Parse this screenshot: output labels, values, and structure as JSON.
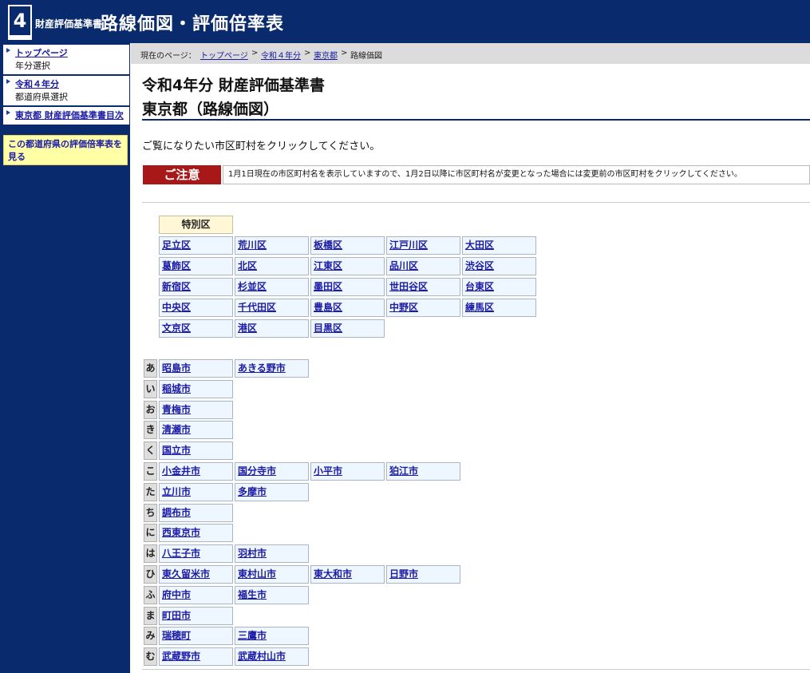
{
  "header": {
    "logo_number": "4",
    "subtitle": "財産評価基準書",
    "title": "路線価図・評価倍率表"
  },
  "sidebar": {
    "items": [
      {
        "link": "トップページ",
        "sub": "年分選択"
      },
      {
        "link": "令和４年分",
        "sub": "都道府県選択"
      },
      {
        "link": "東京都  財産評価基準書目次",
        "sub": ""
      }
    ],
    "notice": "この都道府県の評価倍率表を見る"
  },
  "breadcrumb": {
    "label": "現在のページ：",
    "items": [
      "トップページ",
      "令和４年分",
      "東京都",
      "路線価図"
    ],
    "sep": ">"
  },
  "main": {
    "title_line1": "令和4年分 財産評価基準書",
    "title_line2": "東京都（路線価図）",
    "instruction": "ご覧になりたい市区町村をクリックしてください。",
    "notice_label": "ご注意",
    "notice_text": "1月1日現在の市区町村名を表示していますので、1月2日以降に市区町村名が変更となった場合には変更前の市区町村をクリックしてください。"
  },
  "wards": {
    "header": "特別区",
    "rows": [
      [
        "足立区",
        "荒川区",
        "板橋区",
        "江戸川区",
        "大田区"
      ],
      [
        "葛飾区",
        "北区",
        "江東区",
        "品川区",
        "渋谷区"
      ],
      [
        "新宿区",
        "杉並区",
        "墨田区",
        "世田谷区",
        "台東区"
      ],
      [
        "中央区",
        "千代田区",
        "豊島区",
        "中野区",
        "練馬区"
      ],
      [
        "文京区",
        "港区",
        "目黒区"
      ]
    ]
  },
  "cities": [
    {
      "kana": "あ",
      "items": [
        "昭島市",
        "あきる野市"
      ]
    },
    {
      "kana": "い",
      "items": [
        "稲城市"
      ]
    },
    {
      "kana": "お",
      "items": [
        "青梅市"
      ]
    },
    {
      "kana": "き",
      "items": [
        "清瀬市"
      ]
    },
    {
      "kana": "く",
      "items": [
        "国立市"
      ]
    },
    {
      "kana": "こ",
      "items": [
        "小金井市",
        "国分寺市",
        "小平市",
        "狛江市"
      ]
    },
    {
      "kana": "た",
      "items": [
        "立川市",
        "多摩市"
      ]
    },
    {
      "kana": "ち",
      "items": [
        "調布市"
      ]
    },
    {
      "kana": "に",
      "items": [
        "西東京市"
      ]
    },
    {
      "kana": "は",
      "items": [
        "八王子市",
        "羽村市"
      ]
    },
    {
      "kana": "ひ",
      "items": [
        "東久留米市",
        "東村山市",
        "東大和市",
        "日野市"
      ]
    },
    {
      "kana": "ふ",
      "items": [
        "府中市",
        "福生市"
      ]
    },
    {
      "kana": "ま",
      "items": [
        "町田市"
      ]
    },
    {
      "kana": "み",
      "items": [
        "瑞穂町",
        "三鷹市"
      ]
    },
    {
      "kana": "む",
      "items": [
        "武蔵野市",
        "武蔵村山市"
      ]
    }
  ]
}
